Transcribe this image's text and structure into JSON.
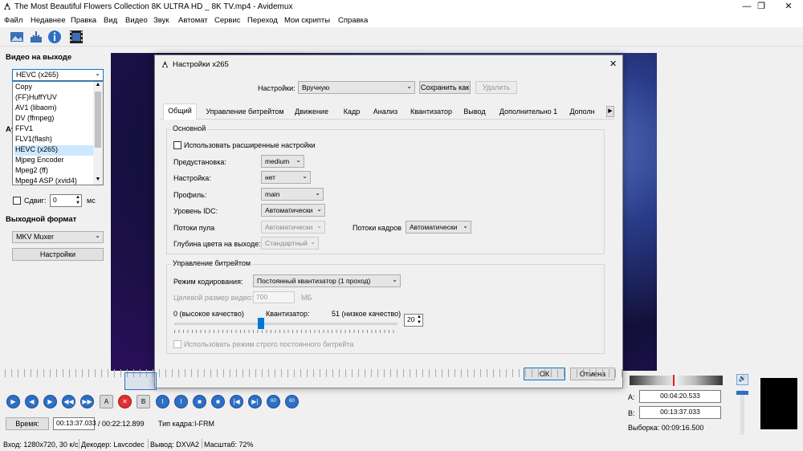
{
  "window": {
    "title": "The Most Beautiful Flowers Collection 8K ULTRA HD _ 8K TV.mp4 - Avidemux",
    "minimize": "—",
    "maximize": "❐",
    "close": "✕"
  },
  "menu": [
    "Файл",
    "Недавнее",
    "Правка",
    "Вид",
    "Видео",
    "Звук",
    "Автомат",
    "Сервис",
    "Переход",
    "Мои скрипты",
    "Справка"
  ],
  "left": {
    "video_out_title": "Видео на выходе",
    "video_codec": "HEVC (x265)",
    "codecs": [
      "Copy",
      "(FF)HuffYUV",
      "AV1 (libaom)",
      "DV (ffmpeg)",
      "FFV1",
      "FLV1(flash)",
      "HEVC (x265)",
      "Mjpeg Encoder",
      "Mpeg2 (ff)",
      "Mpeg4 ASP (xvid4)"
    ],
    "audio_partial": "Ау",
    "shift_label": "Сдвиг:",
    "shift_value": "0",
    "shift_unit": "мс",
    "format_title": "Выходной формат",
    "muxer": "MKV Muxer",
    "settings_btn": "Настройки"
  },
  "dialog": {
    "title": "Настройки x265",
    "close": "✕",
    "preset_label": "Настройки:",
    "preset_value": "Вручную",
    "save_as": "Сохранить как",
    "delete": "Удалить",
    "tabs": [
      "Общий",
      "Управление битрейтом",
      "Движение",
      "Кадр",
      "Анализ",
      "Квантизатор",
      "Вывод",
      "Дополнительно 1",
      "Дополн"
    ],
    "basic": {
      "title": "Основной",
      "advanced_chk": "Использовать расширенные настройки",
      "preset_label": "Предустановка:",
      "preset_value": "medium",
      "tune_label": "Настройка:",
      "tune_value": "нет",
      "profile_label": "Профиль:",
      "profile_value": "main",
      "idc_label": "Уровень IDC:",
      "idc_value": "Автоматически",
      "pool_label": "Потоки пула",
      "pool_value": "Автоматически",
      "frame_threads_label": "Потоки кадров",
      "frame_threads_value": "Автоматически",
      "depth_label": "Глубина цвета на выходе:",
      "depth_value": "Стандартный"
    },
    "rate": {
      "title": "Управление битрейтом",
      "mode_label": "Режим кодирования:",
      "mode_value": "Постоянный квантизатор (1 проход)",
      "target_label": "Целевой размер видео:",
      "target_value": "700",
      "target_unit": "МБ",
      "q_low": "0 (высокое качество)",
      "q_label": "Квантизатор:",
      "q_high": "51 (низкое качество)",
      "q_value": "20",
      "q_fraction": 0.39,
      "strict_chk": "Использовать режим строго постоянного битрейта"
    },
    "ok": "ОК",
    "cancel": "Отмена"
  },
  "player": {
    "buttons": [
      "▶",
      "◀",
      "▶",
      "◀◀",
      "▶▶",
      "A",
      "✕",
      "B",
      "I",
      "I",
      "■",
      "■",
      "|◀",
      "▶|",
      "60",
      "60"
    ],
    "time_btn": "Время:",
    "current_time": "00:13:37.033",
    "total_time": "/ 00:22:12.899",
    "frame_type_label": "Тип кадра:",
    "frame_type": "I-FRM",
    "a_label": "A:",
    "a_time": "00:04:20.533",
    "b_label": "B:",
    "b_time": "00:13:37.033",
    "selection": "Выборка: 00:09:16.500",
    "volume_icon": "🔊"
  },
  "status": {
    "input": "Вход: 1280x720, 30 к/с",
    "decoder": "Декодер: Lavcodec",
    "output": "Вывод: DXVA2",
    "scale": "Масштаб: 72%"
  }
}
